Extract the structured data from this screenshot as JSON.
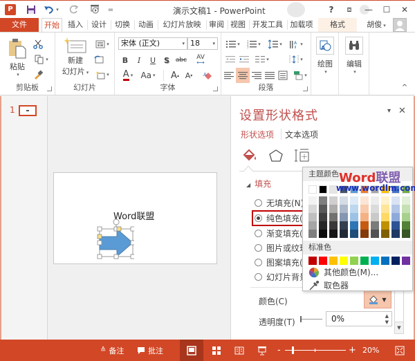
{
  "window": {
    "title": "演示文稿1 - PowerPoint",
    "help": "?",
    "ribbon_display": "⧈",
    "minimize": "—",
    "maximize": "☐",
    "close": "✕"
  },
  "quick_access": {
    "app_icon": "P",
    "save": "save-icon",
    "undo": "undo-icon",
    "redo": "redo-icon",
    "presentation": "start-from-beginning-icon",
    "customize": "="
  },
  "tabs": [
    {
      "label": "文件"
    },
    {
      "label": "开始"
    },
    {
      "label": "插入"
    },
    {
      "label": "设计"
    },
    {
      "label": "切换"
    },
    {
      "label": "动画"
    },
    {
      "label": "幻灯片放映"
    },
    {
      "label": "审阅"
    },
    {
      "label": "视图"
    },
    {
      "label": "开发工具"
    },
    {
      "label": "加载项"
    },
    {
      "label": "格式"
    }
  ],
  "user": {
    "name": "胡俊",
    "caret": "▾"
  },
  "ribbon": {
    "clipboard": {
      "label": "剪贴板",
      "paste": "粘贴"
    },
    "slides": {
      "label": "幻灯片",
      "new_slide_line1": "新建",
      "new_slide_line2": "幻灯片"
    },
    "font": {
      "label": "字体",
      "font_name": "宋体 (正文)",
      "font_size": "18",
      "bold": "B",
      "italic": "I",
      "underline": "U",
      "shadow": "S",
      "strikethrough": "abc",
      "spacing": "AV",
      "font_color": "A",
      "change_case": "Aa",
      "grow": "A",
      "shrink": "A"
    },
    "paragraph": {
      "label": "段落"
    },
    "drawing": {
      "label": "绘图"
    },
    "editing": {
      "label": "编辑"
    },
    "collapse": "^"
  },
  "slide_pane": {
    "slide_number": "1"
  },
  "slide": {
    "text": "Word联盟"
  },
  "format_pane": {
    "title": "设置形状格式",
    "menu_caret": "▾",
    "close": "✕",
    "tabs": [
      {
        "label": "形状选项",
        "active": true
      },
      {
        "label": "文本选项",
        "active": false
      }
    ],
    "section": {
      "toggle": "◢",
      "label": "填充"
    },
    "fill_options": [
      {
        "label": "无填充(N)",
        "selected": false
      },
      {
        "label": "纯色填充(S)",
        "selected": true
      },
      {
        "label": "渐变填充(G)",
        "selected": false
      },
      {
        "label": "图片或纹理填充(P)",
        "selected": false
      },
      {
        "label": "图案填充(A)",
        "selected": false
      },
      {
        "label": "幻灯片背景填充(B)",
        "selected": false
      }
    ],
    "color_label": "颜色(C)",
    "transparency_label": "透明度(T)",
    "transparency_value": "0%"
  },
  "color_picker": {
    "theme_header": "主题颜色",
    "standard_header": "标准色",
    "more_colors": "其他颜色(M)...",
    "eyedropper": "取色器",
    "watermark_word": "Word",
    "watermark_cn": "联盟",
    "watermark_url": "www.wordlm.com",
    "theme_top": [
      "#ffffff",
      "#000000",
      "#e7e6e6",
      "#44546a",
      "#5b9bd5",
      "#ed7d31",
      "#a5a5a5",
      "#ffc000",
      "#4472c4",
      "#70ad47"
    ],
    "theme_shades": [
      [
        "#f2f2f2",
        "#7f7f7f",
        "#d0cece",
        "#d6dce4",
        "#deebf6",
        "#fbe5d5",
        "#ededed",
        "#fff2cc",
        "#dae3f3",
        "#e2efd9"
      ],
      [
        "#d8d8d8",
        "#595959",
        "#aeabab",
        "#adb9ca",
        "#bdd7ee",
        "#f7cbac",
        "#dbdbdb",
        "#fee599",
        "#b4c6e7",
        "#c5e0b3"
      ],
      [
        "#bfbfbf",
        "#3f3f3f",
        "#757070",
        "#8496b0",
        "#9cc3e5",
        "#f4b183",
        "#c9c9c9",
        "#ffd965",
        "#8eaadb",
        "#a8d08d"
      ],
      [
        "#a5a5a5",
        "#262626",
        "#3a3838",
        "#323f4f",
        "#2e75b5",
        "#c55a11",
        "#7b7b7b",
        "#bf9000",
        "#2f5496",
        "#538135"
      ],
      [
        "#7f7f7f",
        "#0c0c0c",
        "#171616",
        "#222a35",
        "#1e4e79",
        "#843c0b",
        "#525252",
        "#7f6000",
        "#1f3864",
        "#375623"
      ]
    ],
    "standard": [
      "#c00000",
      "#ff0000",
      "#ffc000",
      "#ffff00",
      "#92d050",
      "#00b050",
      "#00b0f0",
      "#0070c0",
      "#002060",
      "#7030a0"
    ]
  },
  "status_bar": {
    "notes": "备注",
    "comments": "批注",
    "zoom_minus": "-",
    "zoom_plus": "+",
    "zoom_level": "20%"
  },
  "colors": {
    "accent": "#d24726",
    "pane_title": "#c0504d",
    "shape_fill": "#5b9bd5",
    "highlight": "#f6c6ad"
  }
}
